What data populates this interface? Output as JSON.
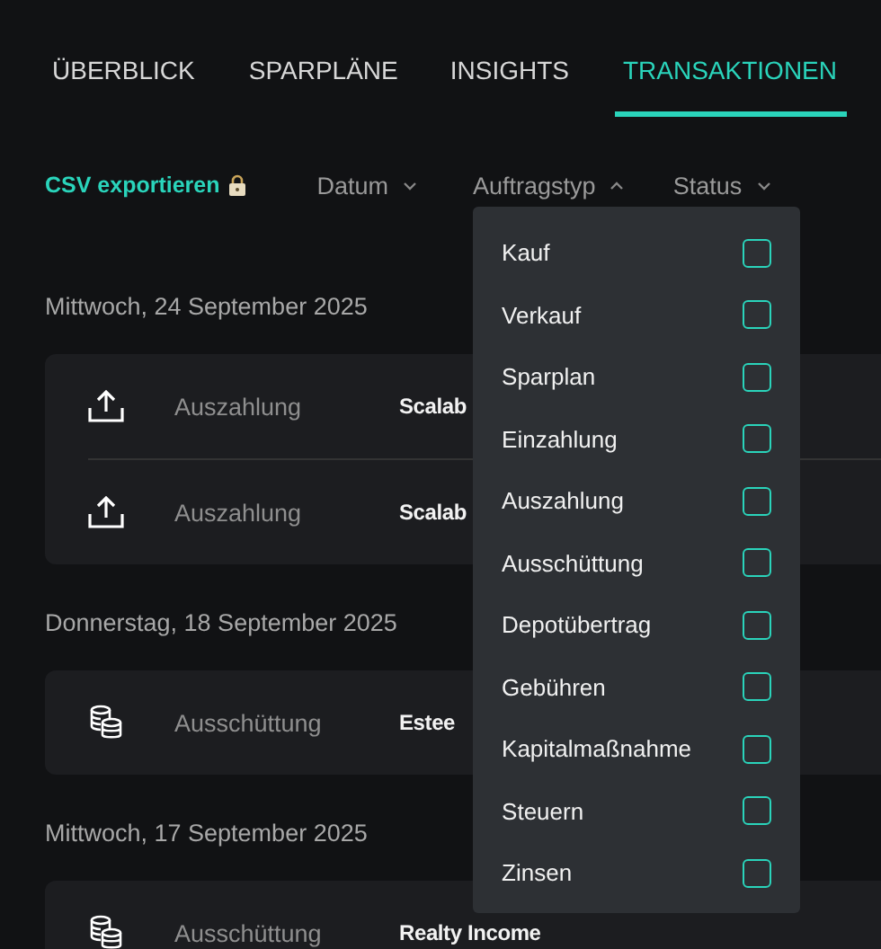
{
  "tabs": [
    {
      "label": "ÜBERBLICK",
      "selected": false
    },
    {
      "label": "SPARPLÄNE",
      "selected": false
    },
    {
      "label": "INSIGHTS",
      "selected": false
    },
    {
      "label": "TRANSAKTIONEN",
      "selected": true
    }
  ],
  "filters": [
    {
      "kind": "export",
      "label": "CSV exportieren",
      "locked": true
    },
    {
      "kind": "dropdown",
      "label": "Datum",
      "expanded": false
    },
    {
      "kind": "dropdown",
      "label": "Auftragstyp",
      "expanded": true
    },
    {
      "kind": "dropdown",
      "label": "Status",
      "expanded": false
    }
  ],
  "type_menu": {
    "options": [
      {
        "label": "Kauf",
        "checked": false
      },
      {
        "label": "Verkauf",
        "checked": false
      },
      {
        "label": "Sparplan",
        "checked": false
      },
      {
        "label": "Einzahlung",
        "checked": false
      },
      {
        "label": "Auszahlung",
        "checked": false
      },
      {
        "label": "Ausschüttung",
        "checked": false
      },
      {
        "label": "Depotübertrag",
        "checked": false
      },
      {
        "label": "Gebühren",
        "checked": false
      },
      {
        "label": "Kapitalmaßnahme",
        "checked": false
      },
      {
        "label": "Steuern",
        "checked": false
      },
      {
        "label": "Zinsen",
        "checked": false
      }
    ]
  },
  "days": [
    {
      "date": "Mittwoch, 24 September 2025",
      "transactions": [
        {
          "kind": "withdrawal",
          "type": "Auszahlung",
          "name": "Scalab"
        },
        {
          "kind": "withdrawal",
          "type": "Auszahlung",
          "name": "Scalab"
        }
      ]
    },
    {
      "date": "Donnerstag, 18 September 2025",
      "transactions": [
        {
          "kind": "distribution",
          "type": "Ausschüttung",
          "name": "Estee"
        }
      ]
    },
    {
      "date": "Mittwoch, 17 September 2025",
      "transactions": [
        {
          "kind": "distribution",
          "type": "Ausschüttung",
          "name": "Realty Income"
        }
      ]
    }
  ]
}
